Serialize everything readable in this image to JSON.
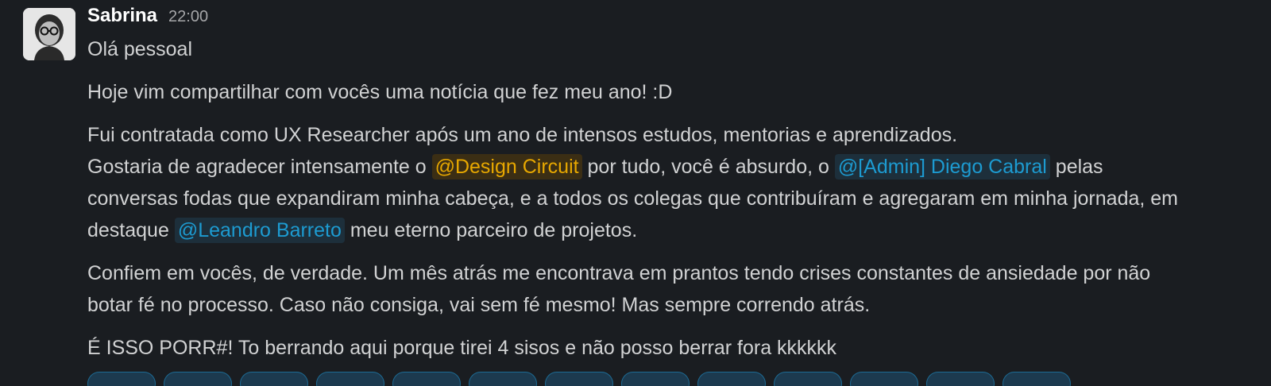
{
  "message": {
    "author": "Sabrina",
    "timestamp": "22:00",
    "greeting": "Olá pessoal",
    "p1": "Hoje vim compartilhar com vocês uma notícia que fez meu ano! :D",
    "p2_line1": "Fui contratada como UX Researcher após um ano de intensos estudos, mentorias e aprendizados.",
    "p2_line2_pre": "Gostaria de agradecer intensamente o ",
    "mention_design": "@Design Circuit",
    "p2_line2_mid": " por tudo, você é absurdo, o ",
    "mention_diego": "@[Admin] Diego Cabral",
    "p2_line2_post": " pelas",
    "p2_line3": "conversas fodas que expandiram minha cabeça, e a todos os colegas que contribuíram e agregaram em minha jornada, em",
    "p2_line4_pre": "destaque ",
    "mention_leandro": "@Leandro Barreto",
    "p2_line4_post": " meu eterno parceiro de projetos.",
    "p3_line1": "Confiem em vocês, de verdade. Um mês atrás me encontrava em prantos tendo crises constantes de ansiedade por não",
    "p3_line2": "botar fé no processo. Caso não consiga, vai sem fé mesmo! Mas sempre correndo atrás.",
    "p4": "É ISSO PORR#! To berrando aqui porque tirei 4 sisos e não posso berrar fora kkkkkk"
  },
  "colors": {
    "background": "#1a1d21",
    "text": "#d1d2d3",
    "mention_user": "#1d9bd1",
    "mention_group": "#e8a800"
  }
}
